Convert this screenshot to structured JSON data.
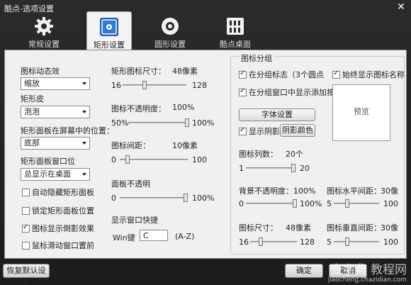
{
  "window": {
    "title": "酷点-选项设置",
    "close": "✕"
  },
  "tabs": [
    {
      "label": "常规设置",
      "icon": "gear-icon"
    },
    {
      "label": "矩形设置",
      "icon": "rectangle-settings-icon"
    },
    {
      "label": "圆形设置",
      "icon": "circle-settings-icon"
    },
    {
      "label": "酷点桌面",
      "icon": "desktop-grid-icon"
    }
  ],
  "left": {
    "anim_label": "图标动态效",
    "anim_value": "缩放",
    "skin_label": "矩形皮",
    "skin_value": "泡泡",
    "pos_label": "矩形面板在屏幕中的位置：",
    "pos_value": "底部",
    "winpos_label": "矩形面板窗口位",
    "winpos_value": "总显示在桌面",
    "checks": [
      {
        "label": "自动隐藏矩形面板",
        "checked": false
      },
      {
        "label": "锁定矩形面板位置",
        "checked": false
      },
      {
        "label": "图标显示倒影效果",
        "checked": true
      },
      {
        "label": "鼠标滑动窗口置前",
        "checked": false
      }
    ]
  },
  "middle": {
    "size_label": "矩形图标尺寸：",
    "size_value": "48像素",
    "size_min": "16",
    "size_max": "128",
    "opacity_label": "图标不透明度：",
    "opacity_value": "100%",
    "opacity_min": "50%",
    "opacity_max": "100%",
    "spacing_label": "图标间距：",
    "spacing_value": "10像素",
    "spacing_min": "0",
    "spacing_max": "100",
    "panel_label": "面板不透明",
    "panel_min": "0",
    "panel_max": "100%",
    "hotkey_title": "显示窗口快捷",
    "hotkey_label": "Win键",
    "hotkey_value": "C",
    "hotkey_range": "(A-Z)"
  },
  "right": {
    "group_title": "图标分组",
    "check_group_mark": "在分组标志（3个圆点",
    "check_always_name": "始终显示图标名称",
    "check_add_button": "在分组窗口中显示添加按钮",
    "font_button": "字体设置",
    "shadow_check": "显示阴影",
    "shadow_color_button": "阴影颜色",
    "preview": "预览",
    "cols_label": "图标列数：",
    "cols_value": "20个",
    "cols_min": "1",
    "cols_max": "20",
    "bg_label": "背景不透明度：100%",
    "bg_min": "0",
    "bg_max": "100%",
    "hgap_label": "图标水平间距：",
    "hgap_value": "30像",
    "hgap_min": "5",
    "hgap_max": "100",
    "isize_label": "图标尺寸：",
    "isize_value": "48像素",
    "isize_min": "16",
    "isize_max": "128",
    "vgap_label": "图标垂直间距：",
    "vgap_value": "30像",
    "vgap_min": "5",
    "vgap_max": "100"
  },
  "bottom": {
    "restore": "恢复默认设置",
    "ok": "确定",
    "cancel": "取消"
  },
  "watermark": {
    "line1": "查字典 教程网",
    "line2": "jiaocheng.chazidian.com"
  }
}
